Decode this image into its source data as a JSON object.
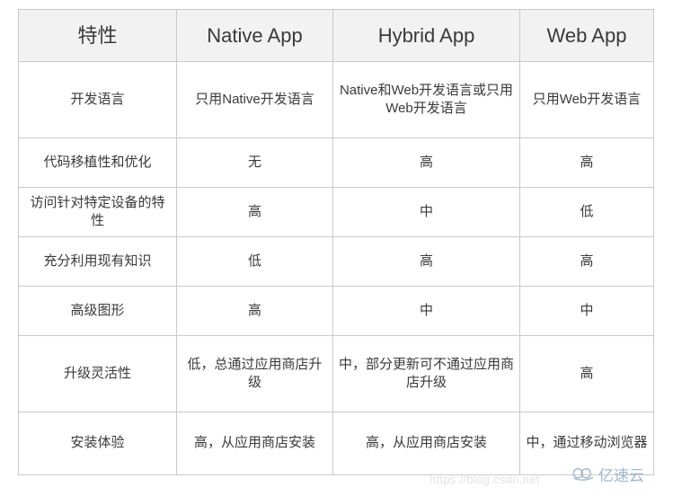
{
  "table": {
    "headers": [
      "特性",
      "Native App",
      "Hybrid App",
      "Web App"
    ],
    "rows": [
      {
        "feature": "开发语言",
        "native": "只用Native开发语言",
        "hybrid": "Native和Web开发语言或只用Web开发语言",
        "web": "只用Web开发语言"
      },
      {
        "feature": "代码移植性和优化",
        "native": "无",
        "hybrid": "高",
        "web": "高"
      },
      {
        "feature": "访问针对特定设备的特性",
        "native": "高",
        "hybrid": "中",
        "web": "低"
      },
      {
        "feature": "充分利用现有知识",
        "native": "低",
        "hybrid": "高",
        "web": "高"
      },
      {
        "feature": "高级图形",
        "native": "高",
        "hybrid": "中",
        "web": "中"
      },
      {
        "feature": "升级灵活性",
        "native": "低，总通过应用商店升级",
        "hybrid": "中，部分更新可不通过应用商店升级",
        "web": "高"
      },
      {
        "feature": "安装体验",
        "native": "高，从应用商店安装",
        "hybrid": "高，从应用商店安装",
        "web": "中，通过移动浏览器"
      }
    ]
  },
  "watermarks": {
    "url": "https://blog.csdn.net",
    "brand": "亿速云",
    "brand_icon": "cloud-logo-icon",
    "brand_color": "#9fb6cd"
  }
}
